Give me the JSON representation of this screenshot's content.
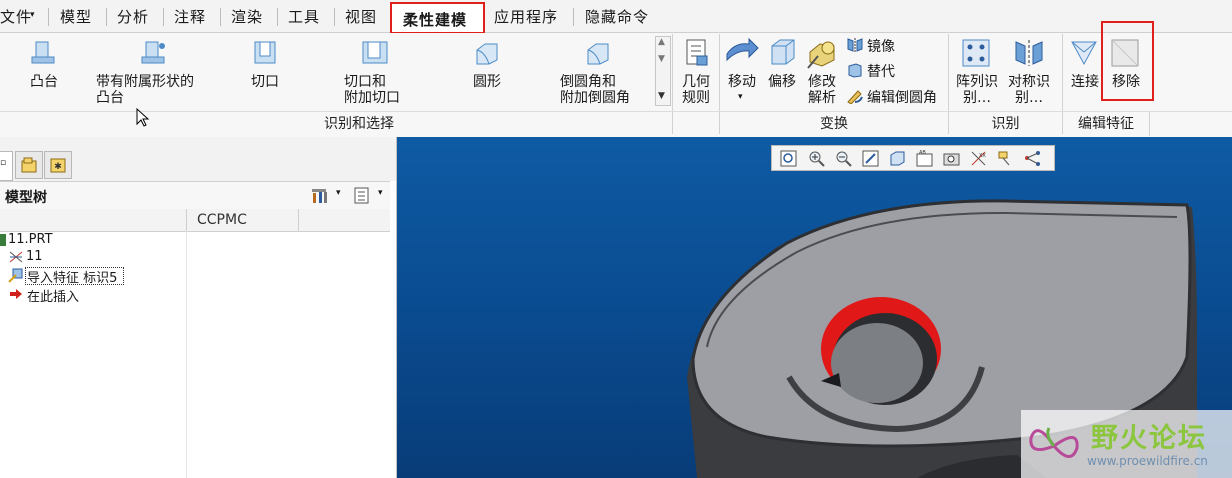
{
  "menubar": {
    "tabs": [
      {
        "label": "文件"
      },
      {
        "label": "模型"
      },
      {
        "label": "分析"
      },
      {
        "label": "注释"
      },
      {
        "label": "渲染"
      },
      {
        "label": "工具"
      },
      {
        "label": "视图"
      },
      {
        "label": "柔性建模"
      },
      {
        "label": "应用程序"
      },
      {
        "label": "隐藏命令"
      }
    ]
  },
  "ribbon": {
    "shape_group": {
      "label": "识别和选择",
      "items": [
        {
          "label": "凸台"
        },
        {
          "label": "带有附属形状的\n凸台"
        },
        {
          "label": "切口"
        },
        {
          "label": "切口和\n附加切口"
        },
        {
          "label": "圆形"
        },
        {
          "label": "倒圆角和\n附加倒圆角"
        }
      ]
    },
    "geometry_rules": {
      "label": "几何\n规则"
    },
    "transform_group": {
      "label": "变换",
      "move": "移动",
      "offset": "偏移",
      "modify": "修改\n解析",
      "mirror": "镜像",
      "replace": "替代",
      "edit_round": "编辑倒圆角"
    },
    "recognize_group": {
      "label": "识别",
      "pattern": "阵列识\n别…",
      "symmetry": "对称识\n别…"
    },
    "edit_group": {
      "label": "编辑特征",
      "connect": "连接",
      "remove": "移除"
    }
  },
  "model_tree": {
    "title": "模型树",
    "column": "CCPMC",
    "rows": [
      {
        "label": "11.PRT"
      },
      {
        "label": "11"
      },
      {
        "label": "导入特征 标识5"
      },
      {
        "label": "在此插入"
      }
    ]
  },
  "watermark": {
    "title": "野火论坛",
    "url": "www.proewildfire.cn"
  },
  "colors": {
    "accent_red": "#e0201c",
    "viewport_blue": "#0b4f96",
    "highlight_red": "#e11818"
  }
}
